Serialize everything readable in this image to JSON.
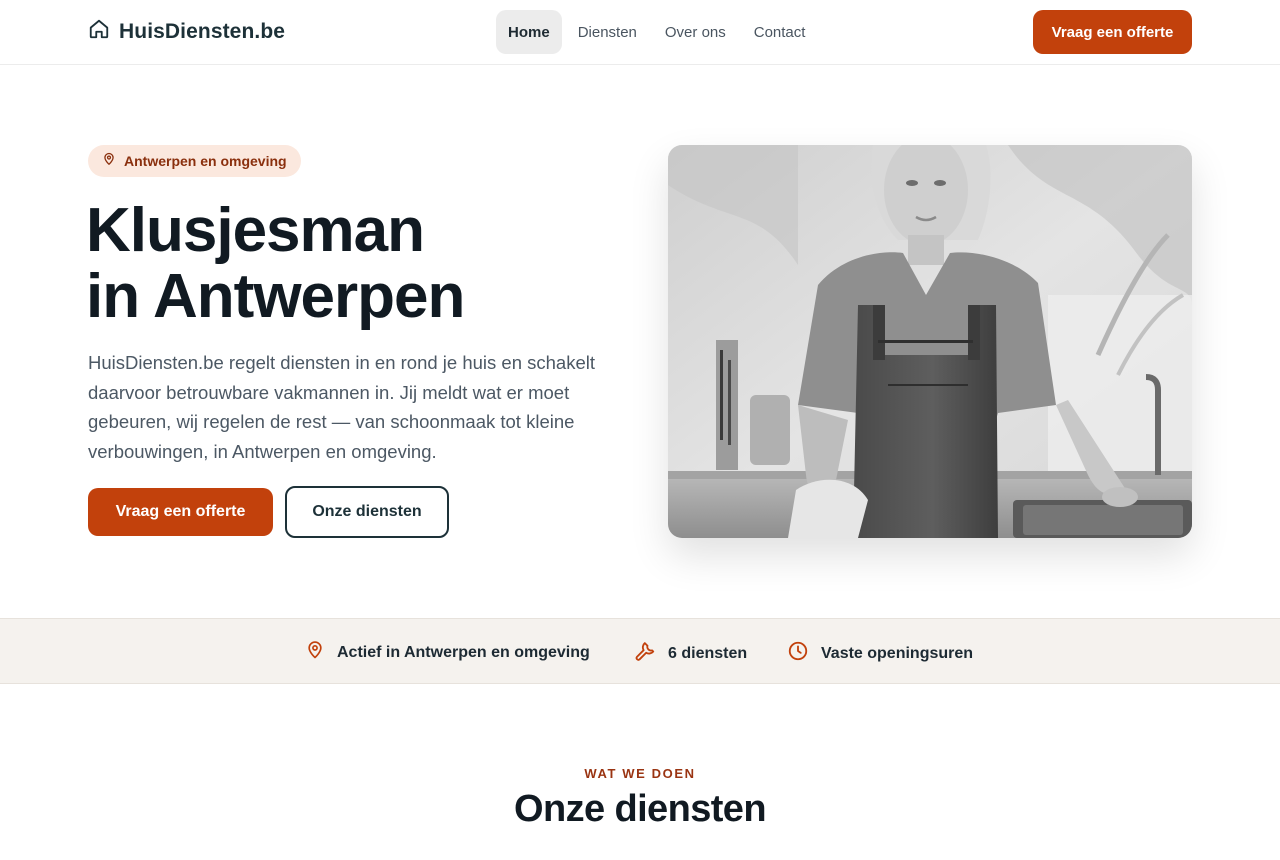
{
  "header": {
    "brand": "HuisDiensten.be",
    "nav": [
      {
        "label": "Home",
        "active": true
      },
      {
        "label": "Diensten",
        "active": false
      },
      {
        "label": "Over ons",
        "active": false
      },
      {
        "label": "Contact",
        "active": false
      }
    ],
    "cta_label": "Vraag een offerte"
  },
  "hero": {
    "badge": "Antwerpen en omgeving",
    "title_line1": "Klusjesman",
    "title_line2": "in Antwerpen",
    "text": "HuisDiensten.be regelt diensten in en rond je huis en schakelt daarvoor betrouwbare vakmannen in. Jij meldt wat er moet gebeuren, wij regelen de rest — van schoonmaak tot kleine verbouwingen, in Antwerpen en omgeving.",
    "primary_button": "Vraag een offerte",
    "secondary_button": "Onze diensten"
  },
  "strip": {
    "items": [
      {
        "icon": "map-pin-icon",
        "label": "Actief in Antwerpen en omgeving"
      },
      {
        "icon": "wrench-icon",
        "label": "6 diensten"
      },
      {
        "icon": "clock-icon",
        "label": "Vaste openingsuren"
      }
    ]
  },
  "services_section": {
    "eyebrow": "WAT WE DOEN",
    "title": "Onze diensten"
  },
  "colors": {
    "accent": "#c2410c",
    "dark": "#1d3138",
    "badge_bg": "#fbe8de",
    "strip_bg": "#f5f2ee"
  }
}
